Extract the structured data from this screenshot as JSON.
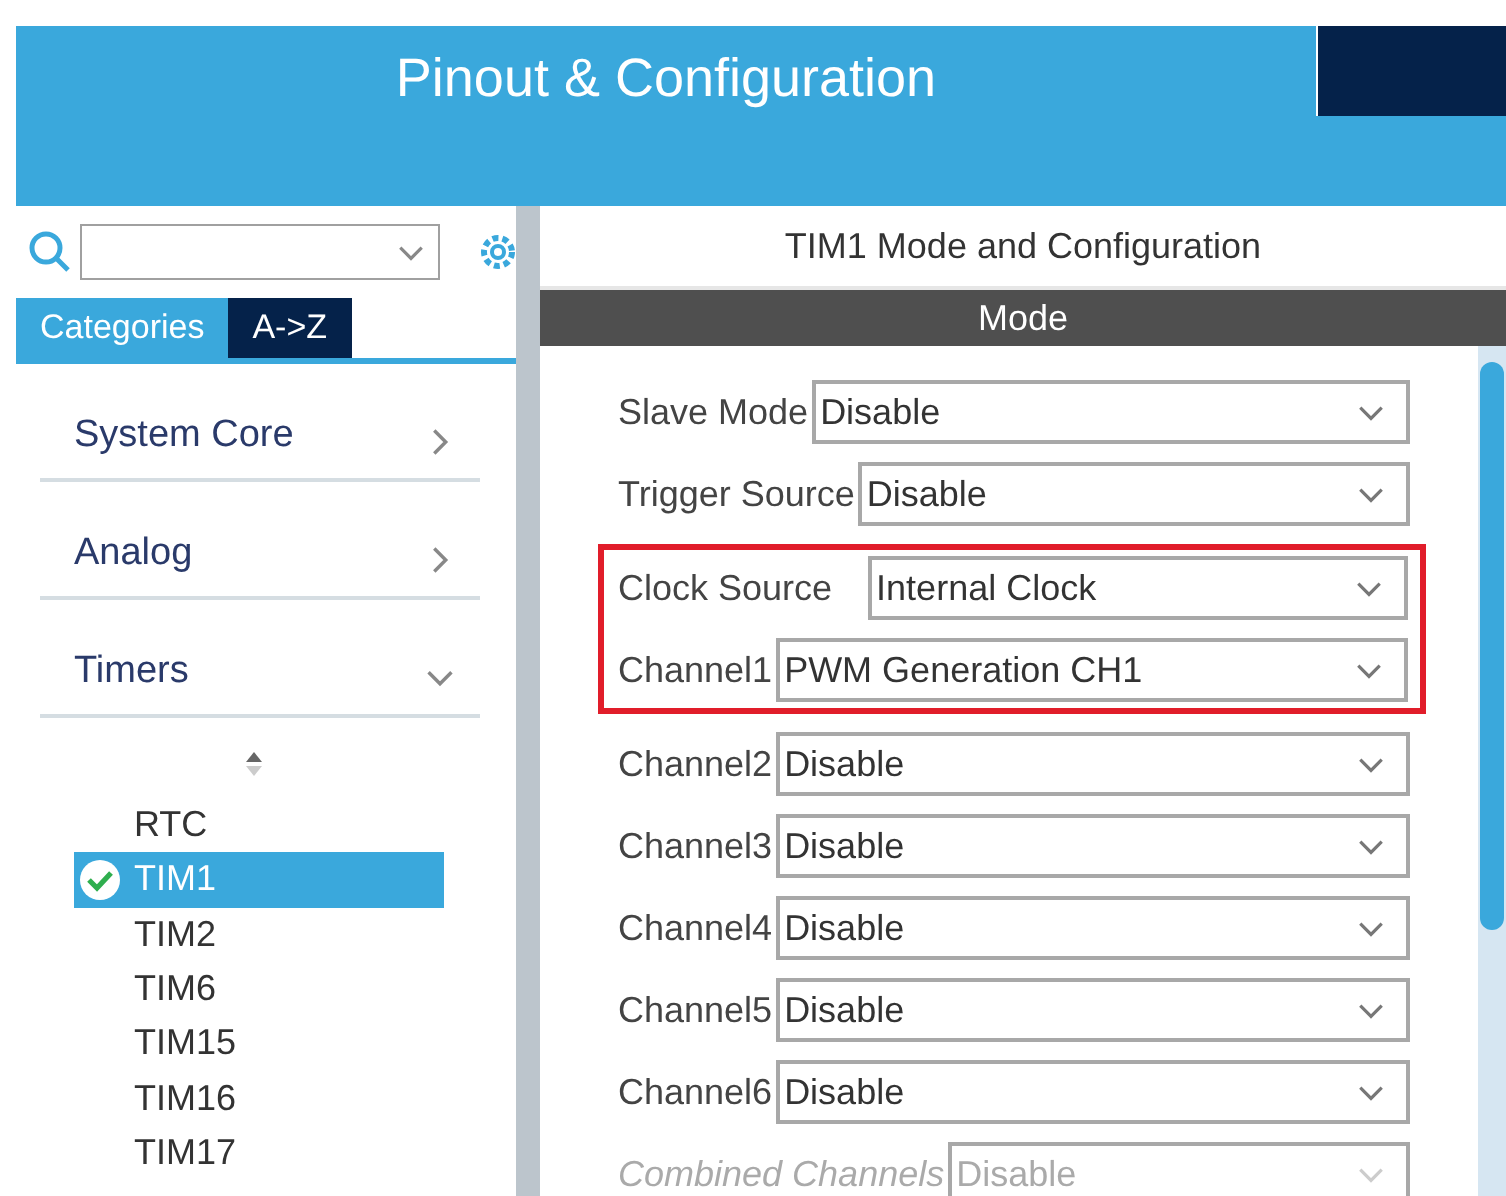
{
  "header": {
    "title": "Pinout & Configuration"
  },
  "sidebar": {
    "tabs": [
      {
        "label": "Categories",
        "selected": true
      },
      {
        "label": "A->Z",
        "selected": false
      }
    ],
    "categories": [
      {
        "label": "System Core",
        "expanded": false
      },
      {
        "label": "Analog",
        "expanded": false
      },
      {
        "label": "Timers",
        "expanded": true,
        "children": [
          {
            "label": "RTC",
            "selected": false,
            "configured": false
          },
          {
            "label": "TIM1",
            "selected": true,
            "configured": true
          },
          {
            "label": "TIM2",
            "selected": false,
            "configured": false
          },
          {
            "label": "TIM6",
            "selected": false,
            "configured": false
          },
          {
            "label": "TIM15",
            "selected": false,
            "configured": false
          },
          {
            "label": "TIM16",
            "selected": false,
            "configured": false
          },
          {
            "label": "TIM17",
            "selected": false,
            "configured": false
          }
        ]
      }
    ]
  },
  "panel": {
    "title": "TIM1 Mode and Configuration",
    "section": "Mode",
    "fields": [
      {
        "label": "Slave Mode",
        "value": "Disable",
        "highlighted": false,
        "disabled": false
      },
      {
        "label": "Trigger Source",
        "value": "Disable",
        "highlighted": false,
        "disabled": false
      },
      {
        "label": "Clock Source",
        "value": "Internal Clock",
        "highlighted": true,
        "disabled": false
      },
      {
        "label": "Channel1",
        "value": "PWM Generation CH1",
        "highlighted": true,
        "disabled": false
      },
      {
        "label": "Channel2",
        "value": "Disable",
        "highlighted": false,
        "disabled": false
      },
      {
        "label": "Channel3",
        "value": "Disable",
        "highlighted": false,
        "disabled": false
      },
      {
        "label": "Channel4",
        "value": "Disable",
        "highlighted": false,
        "disabled": false
      },
      {
        "label": "Channel5",
        "value": "Disable",
        "highlighted": false,
        "disabled": false
      },
      {
        "label": "Channel6",
        "value": "Disable",
        "highlighted": false,
        "disabled": false
      },
      {
        "label": "Combined Channels",
        "value": "Disable",
        "highlighted": false,
        "disabled": true
      }
    ]
  }
}
